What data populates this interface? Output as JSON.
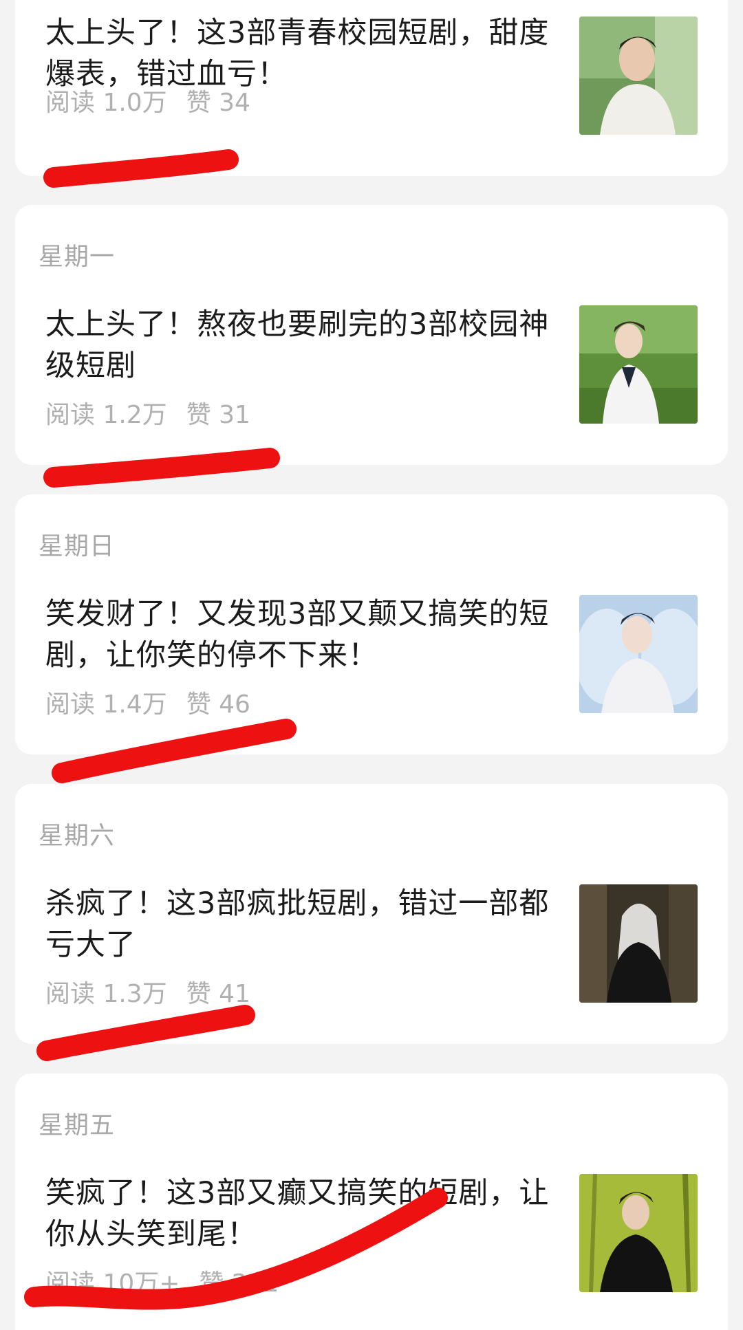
{
  "articles": [
    {
      "date": "",
      "title": "太上头了！这3部青春校园短剧，甜度爆表，错过血亏！",
      "reads": "阅读 1.0万",
      "likes": "赞 34",
      "thumb_icon": "portrait-thumbnail-icon"
    },
    {
      "date": "星期一",
      "title": "太上头了！熬夜也要刷完的3部校园神级短剧",
      "reads": "阅读 1.2万",
      "likes": "赞 31",
      "thumb_icon": "portrait-thumbnail-icon"
    },
    {
      "date": "星期日",
      "title": "笑发财了！又发现3部又颠又搞笑的短剧，让你笑的停不下来！",
      "reads": "阅读 1.4万",
      "likes": "赞 46",
      "thumb_icon": "portrait-thumbnail-icon"
    },
    {
      "date": "星期六",
      "title": "杀疯了！这3部疯批短剧，错过一部都亏大了",
      "reads": "阅读 1.3万",
      "likes": "赞 41",
      "thumb_icon": "portrait-thumbnail-icon"
    },
    {
      "date": "星期五",
      "title": "笑疯了！这3部又癫又搞笑的短剧，让你从头笑到尾！",
      "reads": "阅读 10万+",
      "likes": "赞 212",
      "thumb_icon": "portrait-thumbnail-icon"
    }
  ],
  "colors": {
    "background": "#f3f3f3",
    "card": "#ffffff",
    "title": "#1b1b1b",
    "meta": "#b0b0b0",
    "annotation": "#ee1111"
  }
}
